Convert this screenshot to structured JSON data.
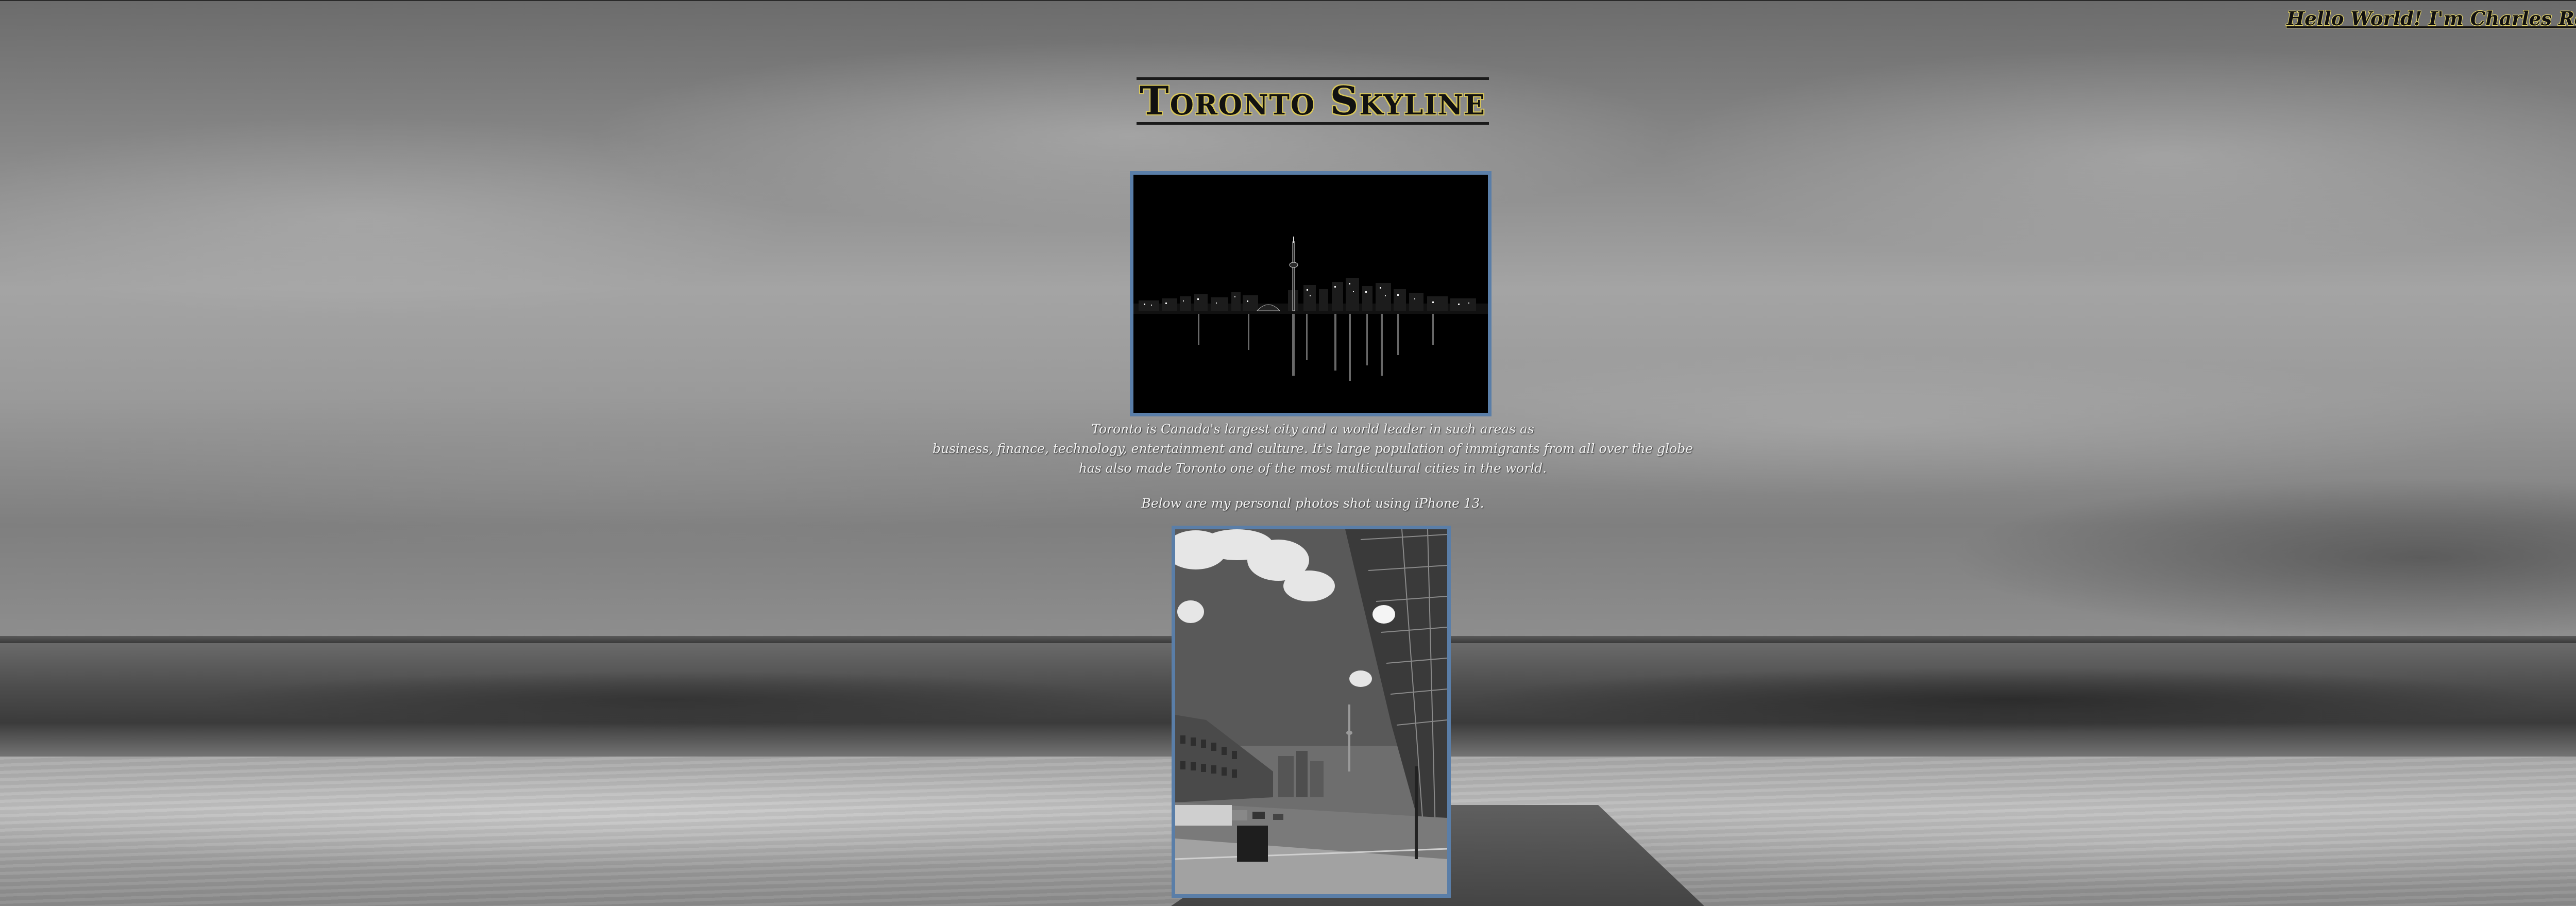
{
  "header": {
    "greeting_link": "Hello World! I'm Charles Reyes"
  },
  "main": {
    "title": "Toronto Skyline",
    "description_lines": [
      "Toronto is Canada's largest city and a world leader in such areas as",
      "business, finance, technology, entertainment and culture. It's large population of immigrants from all over the globe",
      "has also made Toronto one of the most multicultural cities in the world."
    ],
    "photos_note": "Below are my personal photos shot using iPhone 13."
  },
  "colors": {
    "photo_border": "#5a7ea8",
    "title_outline": "#d8c65a",
    "text": "#f2f2f2"
  }
}
